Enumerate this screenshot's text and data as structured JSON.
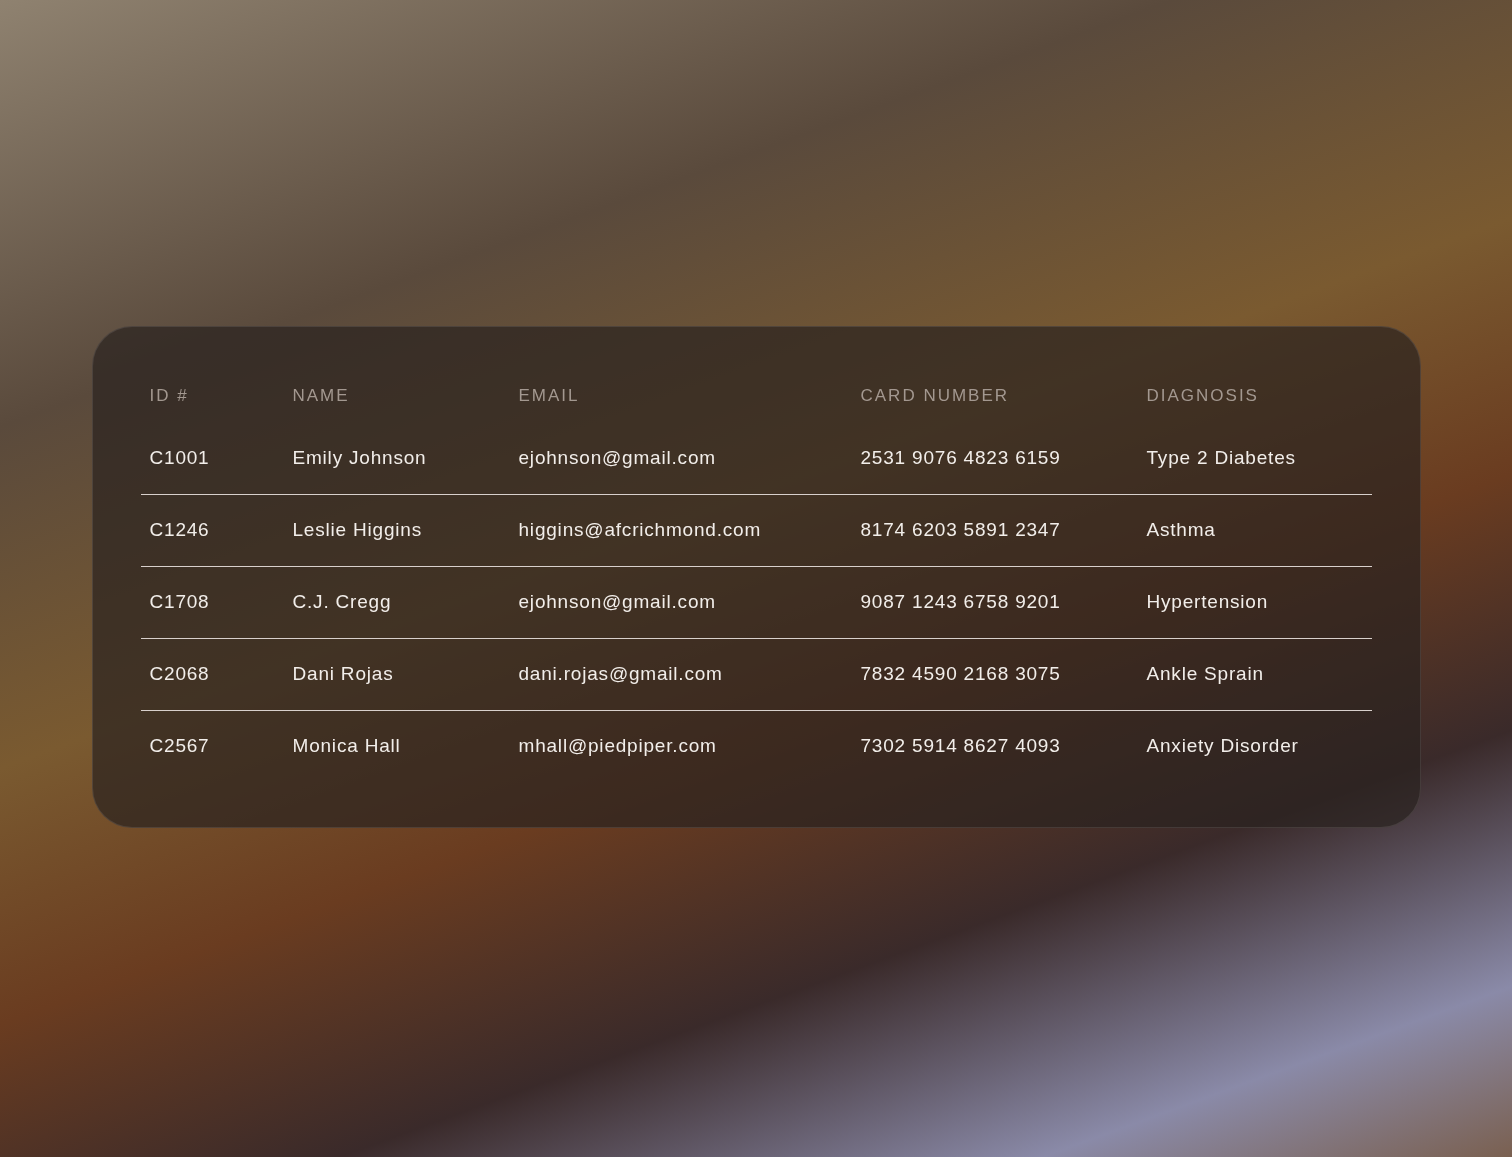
{
  "table": {
    "columns": [
      "ID #",
      "NAME",
      "EMAIL",
      "CARD NUMBER",
      "DIAGNOSIS"
    ],
    "rows": [
      [
        "C1001",
        "Emily Johnson",
        "ejohnson@gmail.com",
        "2531 9076 4823 6159",
        "Type 2 Diabetes"
      ],
      [
        "C1246",
        "Leslie Higgins",
        "higgins@afcrichmond.com",
        "8174 6203 5891 2347",
        "Asthma"
      ],
      [
        "C1708",
        "C.J. Cregg",
        "ejohnson@gmail.com",
        "9087 1243 6758 9201",
        "Hypertension"
      ],
      [
        "C2068",
        "Dani Rojas",
        "dani.rojas@gmail.com",
        "7832 4590 2168 3075",
        "Ankle Sprain"
      ],
      [
        "C2567",
        "Monica Hall",
        "mhall@piedpiper.com",
        "7302 5914 8627 4093",
        "Anxiety Disorder"
      ]
    ]
  }
}
